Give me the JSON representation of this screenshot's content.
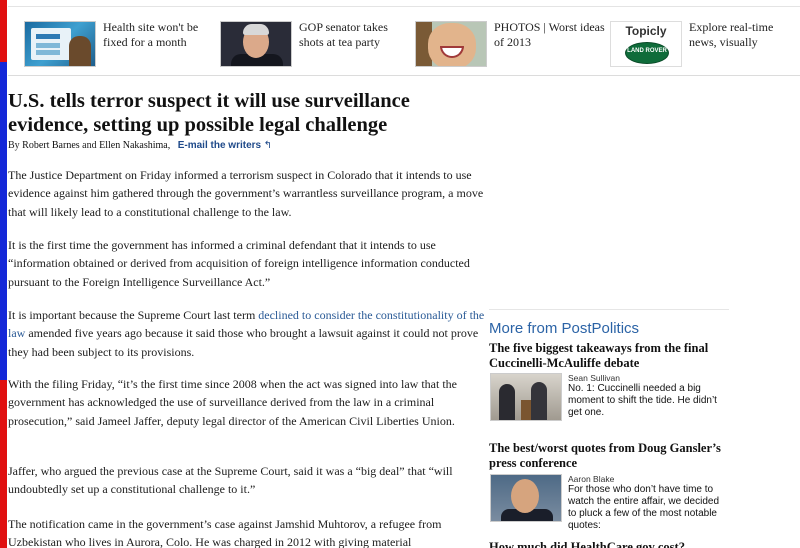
{
  "promo_strip": [
    {
      "text": "Health site won't be fixed for a month",
      "thumb": "laptop-people-thumbnail"
    },
    {
      "text": "GOP senator takes shots at tea party",
      "thumb": "senator-portrait-thumbnail"
    },
    {
      "text": "PHOTOS | Worst ideas of 2013",
      "thumb": "smiling-woman-thumbnail"
    },
    {
      "text": "Explore real-time news, visually",
      "thumb": "topicly-land-rover-ad",
      "ad_label": "Topicly",
      "ad_logo": "LAND ROVER"
    }
  ],
  "article": {
    "headline": "U.S. tells terror suspect it will use surveillance evidence, setting up possible legal challenge",
    "byline_prefix": "By",
    "author1": "Robert Barnes",
    "byline_and": "and",
    "author2": "Ellen Nakashima,",
    "email_writers": "E-mail the writers",
    "p1": "The Justice Department on Friday informed a terrorism suspect in Colorado that it intends to use evidence against him gathered through the government’s warrantless surveillance program, a move that will likely lead to a constitutional challenge to the law.",
    "p2": "It is the first time the government has informed a criminal defendant that it intends to use “information obtained or derived from acquisition of foreign intelligence information conducted pursuant to the Foreign Intelligence Surveillance Act.”",
    "p3_before": "It is important because the Supreme Court last term ",
    "p3_link": "declined to consider the constitutionality of the law",
    "p3_after": " amended five years ago because it said those who brought a lawsuit against it could not prove they had been subject to its provisions.",
    "p4": "With the filing Friday, “it’s the first time since 2008 when the act was signed into law that the government has acknowledged the use of surveillance derived from the law in a criminal prosecution,” said Jameel Jaffer, deputy legal director of the American Civil Liberties Union.",
    "p5": "Jaffer, who argued the previous case at the Supreme Court, said it was a “big deal” that “will undoubtedly set up a constitutional challenge to it.”",
    "p6": "The notification came in the government’s case against Jamshid Muhtorov, a refugee from Uzbekistan who lives in Aurora, Colo. He was charged in 2012 with giving material"
  },
  "sidebar": {
    "title": "More from PostPolitics",
    "stories": [
      {
        "headline": "The five biggest takeaways from the final Cuccinelli-McAuliffe debate",
        "author": "Sean Sullivan",
        "desc": "No. 1: Cuccinelli needed a big moment to shift the tide. He didn’t get one."
      },
      {
        "headline": "The best/worst quotes from Doug Gansler’s press conference",
        "author": "Aaron Blake",
        "desc": "For those who don’t have time to watch the entire affair, we decided to pluck a few of the most notable quotes:"
      }
    ],
    "partial_headline": "How much did HealthCare.gov cost?"
  }
}
